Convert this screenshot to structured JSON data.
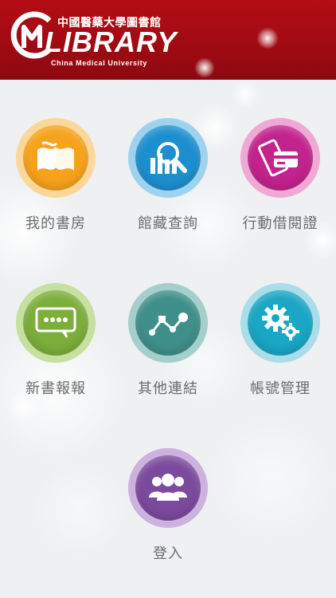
{
  "header": {
    "logo_cn": "中國醫藥大學圖書館",
    "logo_en": "LIBRARY",
    "logo_sub": "China Medical University",
    "background_color": "#a00c14"
  },
  "menu": {
    "my_study": {
      "label": "我的書房",
      "icon": "book-icon",
      "color": "#f7a21b",
      "ring": "#fbd89a"
    },
    "catalog_search": {
      "label": "館藏查詢",
      "icon": "chart-search-icon",
      "color": "#1d8fcf",
      "ring": "#9fd2ee"
    },
    "mobile_card": {
      "label": "行動借閱證",
      "icon": "phone-card-icon",
      "color": "#c2238c",
      "ring": "#f0a9d4"
    },
    "new_books": {
      "label": "新書報報",
      "icon": "message-icon",
      "color": "#7cae3b",
      "ring": "#c6e09f"
    },
    "other_links": {
      "label": "其他連結",
      "icon": "link-path-icon",
      "color": "#3f8f8a",
      "ring": "#a5cfcc"
    },
    "account": {
      "label": "帳號管理",
      "icon": "gears-icon",
      "color": "#1aa6c5",
      "ring": "#a8dde9"
    },
    "login": {
      "label": "登入",
      "icon": "users-icon",
      "color": "#7b4a9e",
      "ring": "#cdb2e0"
    }
  }
}
